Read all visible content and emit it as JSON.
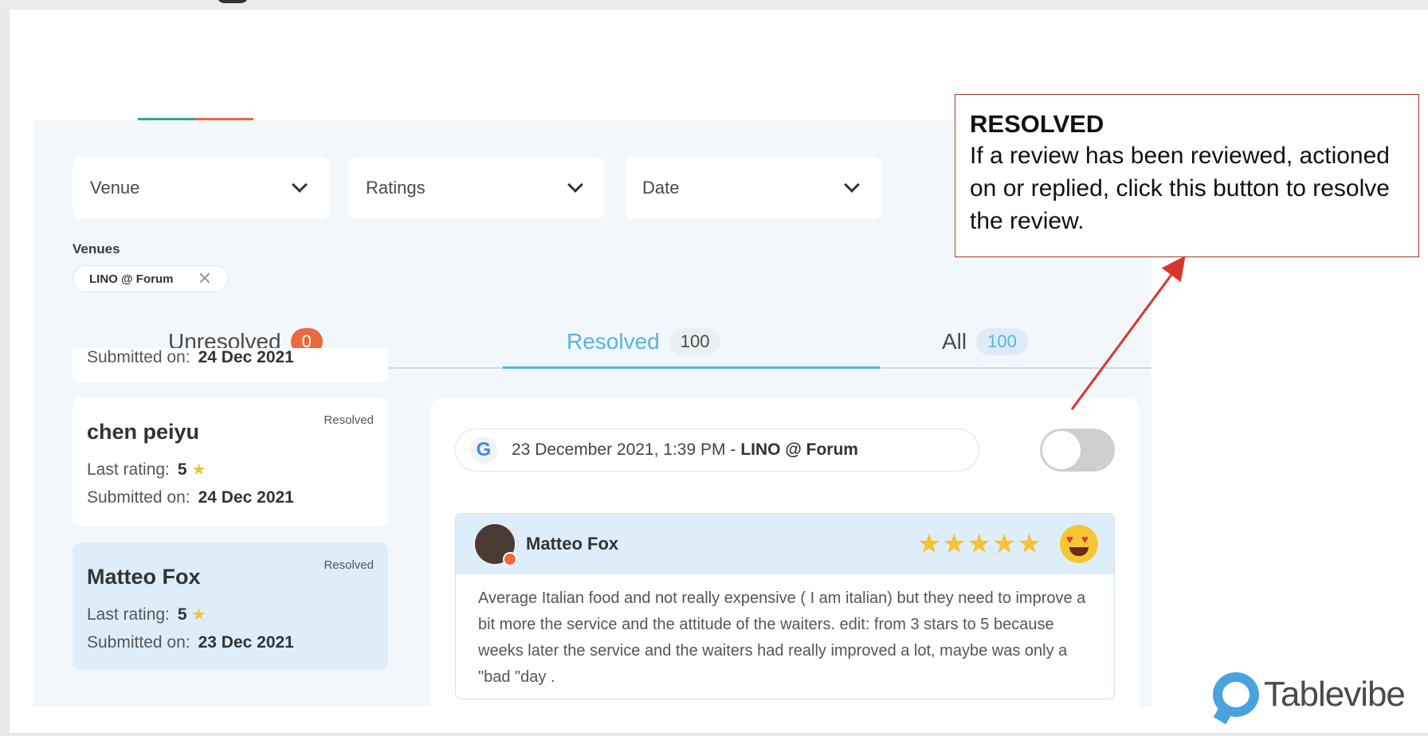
{
  "filters": {
    "venue": "Venue",
    "ratings": "Ratings",
    "date": "Date"
  },
  "venues": {
    "label": "Venues",
    "chip": "LINO @ Forum"
  },
  "tabs": [
    {
      "label": "Unresolved",
      "count": "0"
    },
    {
      "label": "Resolved",
      "count": "100"
    },
    {
      "label": "All",
      "count": "100"
    }
  ],
  "list": {
    "partial": {
      "submitted_label": "Submitted on:",
      "submitted": "24 Dec 2021"
    },
    "cards": [
      {
        "name": "chen peiyu",
        "badge": "Resolved",
        "rating_label": "Last rating:",
        "rating": "5",
        "submitted_label": "Submitted on:",
        "submitted": "24 Dec 2021"
      },
      {
        "name": "Matteo Fox",
        "badge": "Resolved",
        "rating_label": "Last rating:",
        "rating": "5",
        "submitted_label": "Submitted on:",
        "submitted": "23 Dec 2021"
      }
    ]
  },
  "detail": {
    "source_date": "23 December 2021, 1:39 PM -",
    "source_venue": "LINO @ Forum",
    "resolved_toggle": false,
    "reviewer": "Matteo Fox",
    "stars": "★★★★★",
    "rating": 5,
    "text": "Average Italian food and not really expensive ( I am italian) but they need to improve a bit more the service and the attitude of the waiters. edit: from 3 stars to 5 because weeks later the service and the waiters had really improved a lot, maybe was only a \"bad \"day ."
  },
  "callout": {
    "title": "RESOLVED",
    "body": "If a review has been reviewed, actioned on or replied, click this button to resolve the review."
  },
  "logo": {
    "text": "Tablevibe"
  },
  "icons": {
    "chevron": "chevron-down-icon",
    "remove": "close-icon",
    "star": "star-icon",
    "google": "google-icon"
  },
  "colors": {
    "accent_blue": "#5ab3e0",
    "accent_orange": "#ea6a3e",
    "star": "#f5c232",
    "callout_border": "#a9362b",
    "arrow": "#d9362b"
  }
}
